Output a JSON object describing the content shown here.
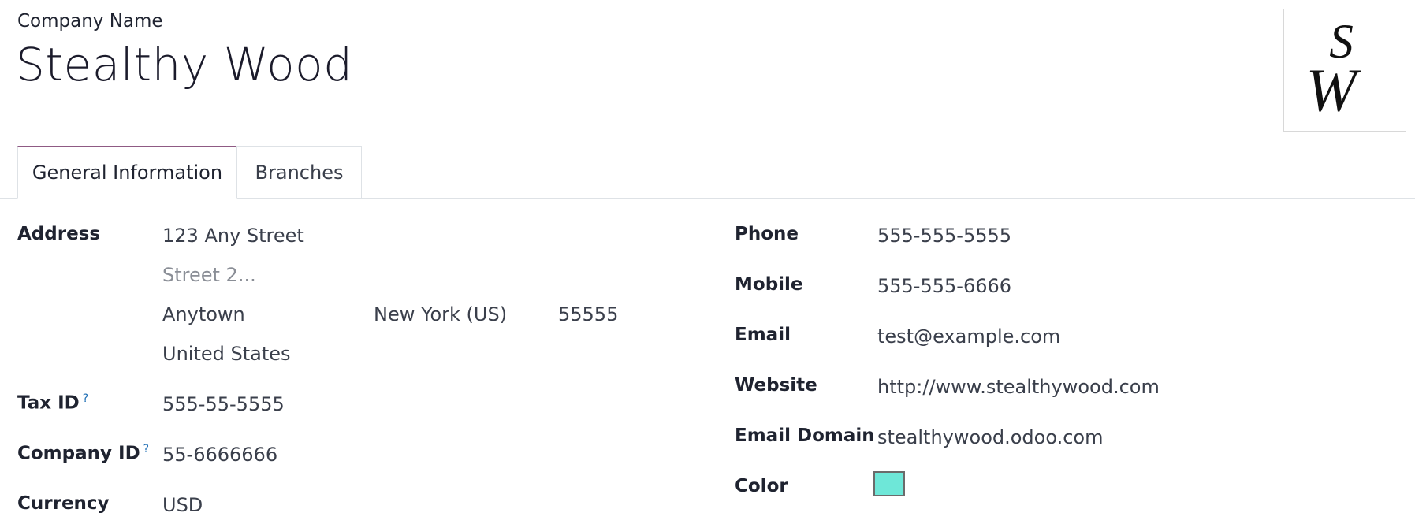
{
  "header": {
    "company_label": "Company Name",
    "company_name": "Stealthy Wood"
  },
  "tabs": [
    {
      "label": "General Information",
      "active": true
    },
    {
      "label": "Branches",
      "active": false
    }
  ],
  "left": {
    "address_label": "Address",
    "street": "123 Any Street",
    "street2_placeholder": "Street 2...",
    "city": "Anytown",
    "state": "New York (US)",
    "zip": "55555",
    "country": "United States",
    "tax_id_label": "Tax ID",
    "tax_id_help": "?",
    "tax_id": "555-55-5555",
    "company_id_label": "Company ID",
    "company_id_help": "?",
    "company_id": "55-6666666",
    "currency_label": "Currency",
    "currency": "USD"
  },
  "right": {
    "phone_label": "Phone",
    "phone": "555-555-5555",
    "mobile_label": "Mobile",
    "mobile": "555-555-6666",
    "email_label": "Email",
    "email": "test@example.com",
    "website_label": "Website",
    "website": "http://www.stealthywood.com",
    "email_domain_label": "Email Domain",
    "email_domain": "stealthywood.odoo.com",
    "color_label": "Color",
    "color_value": "#6ee7d8"
  },
  "colors": {
    "accent_tab_border": "#8f5a84",
    "help_link": "#1f6fb5"
  },
  "logo": {
    "letters": "SW"
  }
}
